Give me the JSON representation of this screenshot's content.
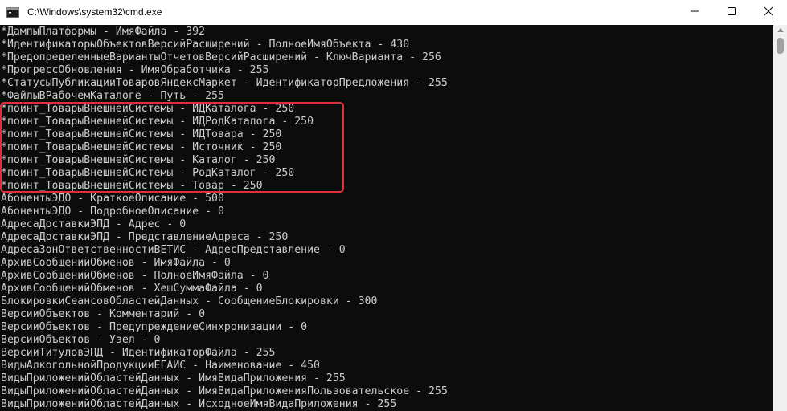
{
  "window": {
    "title": "C:\\Windows\\system32\\cmd.exe",
    "icons": {
      "app": "cmd-icon",
      "minimize": "minimize-icon",
      "maximize": "maximize-icon",
      "close": "close-icon"
    }
  },
  "console": {
    "text_color": "#cccccc",
    "background": "#0c0c0c",
    "highlight_color": "#e0303a",
    "highlighted_lines": [
      6,
      7,
      8,
      9,
      10,
      11,
      12
    ],
    "lines": [
      "*ДампыПлатформы - ИмяФайла - 392",
      "*ИдентификаторыОбъектовВерсийРасширений - ПолноеИмяОбъекта - 430",
      "*ПредопределенныеВариантыОтчетовВерсийРасширений - КлючВарианта - 256",
      "*ПрогрессОбновления - ИмяОбработчика - 255",
      "*СтатусыПубликацииТоваровЯндексМаркет - ИдентификаторПредложения - 255",
      "*ФайлыВРабочемКаталоге - Путь - 255",
      "*поинт_ТоварыВнешнейСистемы - ИДКаталога - 250",
      "*поинт_ТоварыВнешнейСистемы - ИДРодКаталога - 250",
      "*поинт_ТоварыВнешнейСистемы - ИДТовара - 250",
      "*поинт_ТоварыВнешнейСистемы - Источник - 250",
      "*поинт_ТоварыВнешнейСистемы - Каталог - 250",
      "*поинт_ТоварыВнешнейСистемы - РодКаталог - 250",
      "*поинт_ТоварыВнешнейСистемы - Товар - 250",
      "АбонентыЭДО - КраткоеОписание - 500",
      "АбонентыЭДО - ПодробноеОписание - 0",
      "АдресаДоставкиЭПД - Адрес - 0",
      "АдресаДоставкиЭПД - ПредставлениеАдреса - 250",
      "АдресаЗонОтветственностиВЕТИС - АдресПредставление - 0",
      "АрхивСообщенийОбменов - ИмяФайла - 0",
      "АрхивСообщенийОбменов - ПолноеИмяФайла - 0",
      "АрхивСообщенийОбменов - ХешСуммаФайла - 0",
      "БлокировкиСеансовОбластейДанных - СообщениеБлокировки - 300",
      "ВерсииОбъектов - Комментарий - 0",
      "ВерсииОбъектов - ПредупреждениеСинхронизации - 0",
      "ВерсииОбъектов - Узел - 0",
      "ВерсииТитуловЭПД - ИдентификаторФайла - 255",
      "ВидыАлкогольнойПродукцииЕГАИС - Наименование - 450",
      "ВидыПриложенийОбластейДанных - ИмяВидаПриложения - 255",
      "ВидыПриложенийОбластейДанных - ИмяВидаПриложенияПользовательское - 255",
      "ВидыПриложенийОбластейДанных - ИсходноеИмяВидаПриложения - 255"
    ]
  }
}
